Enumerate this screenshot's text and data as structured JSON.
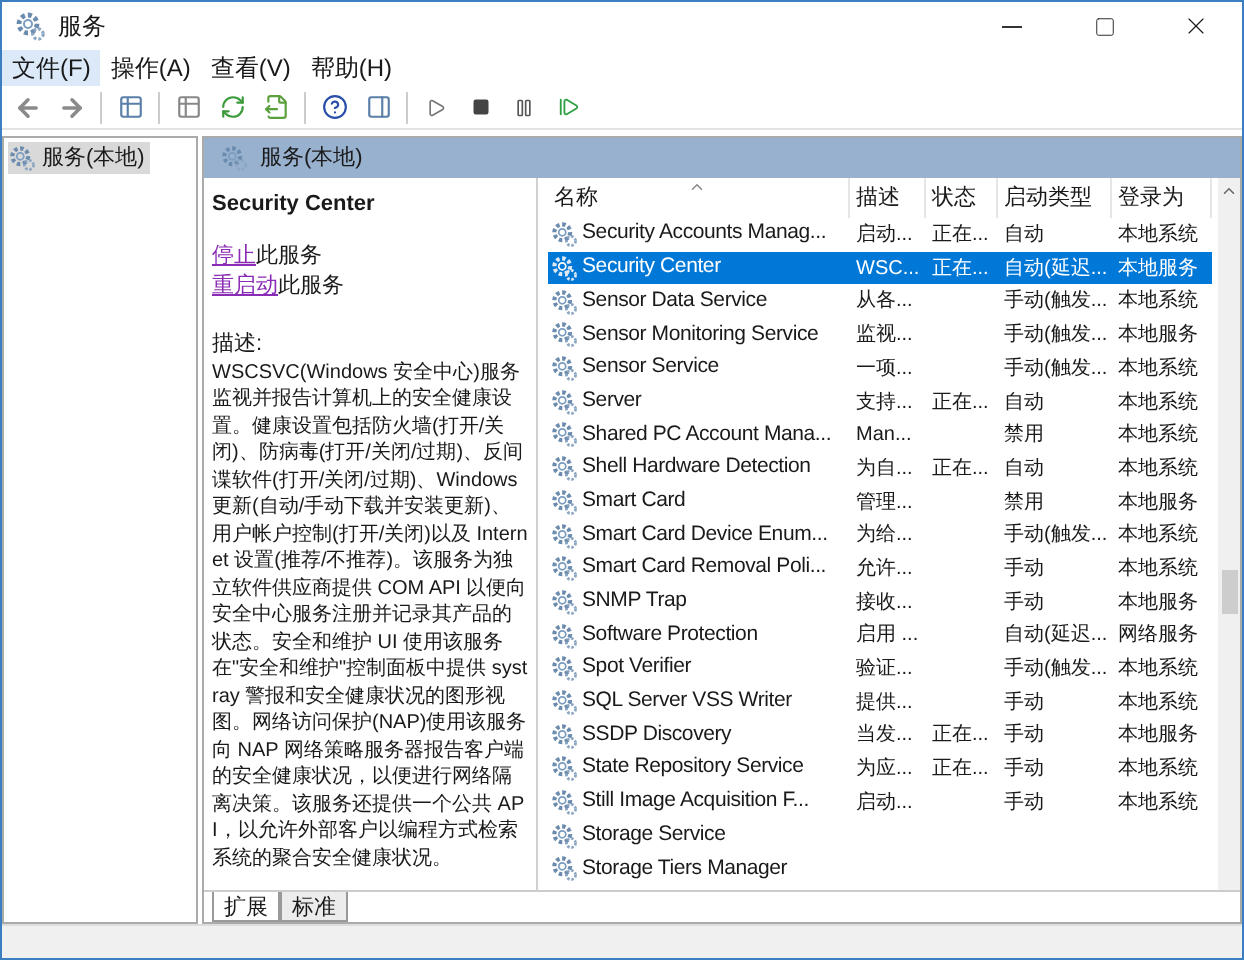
{
  "window": {
    "title": "服务"
  },
  "menu": [
    {
      "label": "文件(F)",
      "selected": true
    },
    {
      "label": "操作(A)",
      "selected": false
    },
    {
      "label": "查看(V)",
      "selected": false
    },
    {
      "label": "帮助(H)",
      "selected": false
    }
  ],
  "tree": {
    "items": [
      {
        "label": "服务(本地)",
        "selected": true
      }
    ]
  },
  "panel": {
    "title": "服务(本地)"
  },
  "details": {
    "service_name": "Security Center",
    "actions": [
      {
        "link": "停止",
        "text": "此服务"
      },
      {
        "link": "重启动",
        "text": "此服务"
      }
    ],
    "description_label": "描述:",
    "description": "WSCSVC(Windows 安全中心)服务监视并报告计算机上的安全健康设置。健康设置包括防火墙(打开/关闭)、防病毒(打开/关闭/过期)、反间谍软件(打开/关闭/过期)、Windows 更新(自动/手动下载并安装更新)、用户帐户控制(打开/关闭)以及 Internet 设置(推荐/不推荐)。该服务为独立软件供应商提供 COM API 以便向安全中心服务注册并记录其产品的状态。安全和维护 UI 使用该服务在\"安全和维护\"控制面板中提供 systray 警报和安全健康状况的图形视图。网络访问保护(NAP)使用该服务向 NAP 网络策略服务器报告客户端的安全健康状况，以便进行网络隔离决策。该服务还提供一个公共 API，以允许外部客户以编程方式检索系统的聚合安全健康状况。"
  },
  "table": {
    "columns": [
      "名称",
      "描述",
      "状态",
      "启动类型",
      "登录为"
    ],
    "rows": [
      {
        "name": "Security Accounts Manag...",
        "description": "启动...",
        "status": "正在...",
        "startup": "自动",
        "logon": "本地系统",
        "selected": false
      },
      {
        "name": "Security Center",
        "description": "WSC...",
        "status": "正在...",
        "startup": "自动(延迟...",
        "logon": "本地服务",
        "selected": true
      },
      {
        "name": "Sensor Data Service",
        "description": "从各...",
        "status": "",
        "startup": "手动(触发...",
        "logon": "本地系统",
        "selected": false
      },
      {
        "name": "Sensor Monitoring Service",
        "description": "监视...",
        "status": "",
        "startup": "手动(触发...",
        "logon": "本地服务",
        "selected": false
      },
      {
        "name": "Sensor Service",
        "description": "一项...",
        "status": "",
        "startup": "手动(触发...",
        "logon": "本地系统",
        "selected": false
      },
      {
        "name": "Server",
        "description": "支持...",
        "status": "正在...",
        "startup": "自动",
        "logon": "本地系统",
        "selected": false
      },
      {
        "name": "Shared PC Account Mana...",
        "description": "Man...",
        "status": "",
        "startup": "禁用",
        "logon": "本地系统",
        "selected": false
      },
      {
        "name": "Shell Hardware Detection",
        "description": "为自...",
        "status": "正在...",
        "startup": "自动",
        "logon": "本地系统",
        "selected": false
      },
      {
        "name": "Smart Card",
        "description": "管理...",
        "status": "",
        "startup": "禁用",
        "logon": "本地服务",
        "selected": false
      },
      {
        "name": "Smart Card Device Enum...",
        "description": "为给...",
        "status": "",
        "startup": "手动(触发...",
        "logon": "本地系统",
        "selected": false
      },
      {
        "name": "Smart Card Removal Poli...",
        "description": "允许...",
        "status": "",
        "startup": "手动",
        "logon": "本地系统",
        "selected": false
      },
      {
        "name": "SNMP Trap",
        "description": "接收...",
        "status": "",
        "startup": "手动",
        "logon": "本地服务",
        "selected": false
      },
      {
        "name": "Software Protection",
        "description": "启用 ...",
        "status": "",
        "startup": "自动(延迟...",
        "logon": "网络服务",
        "selected": false
      },
      {
        "name": "Spot Verifier",
        "description": "验证...",
        "status": "",
        "startup": "手动(触发...",
        "logon": "本地系统",
        "selected": false
      },
      {
        "name": "SQL Server VSS Writer",
        "description": "提供...",
        "status": "",
        "startup": "手动",
        "logon": "本地系统",
        "selected": false
      },
      {
        "name": "SSDP Discovery",
        "description": "当发...",
        "status": "正在...",
        "startup": "手动",
        "logon": "本地服务",
        "selected": false
      },
      {
        "name": "State Repository Service",
        "description": "为应...",
        "status": "正在...",
        "startup": "手动",
        "logon": "本地系统",
        "selected": false
      },
      {
        "name": "Still Image Acquisition F...",
        "description": "启动...",
        "status": "",
        "startup": "手动",
        "logon": "本地系统",
        "selected": false
      },
      {
        "name": "Storage Service",
        "description": "",
        "status": "",
        "startup": "",
        "logon": "",
        "selected": false
      },
      {
        "name": "Storage Tiers Manager",
        "description": "",
        "status": "",
        "startup": "",
        "logon": "",
        "selected": false
      }
    ]
  },
  "view_tabs": [
    {
      "label": "扩展",
      "selected": true
    },
    {
      "label": "标准",
      "selected": false
    }
  ]
}
